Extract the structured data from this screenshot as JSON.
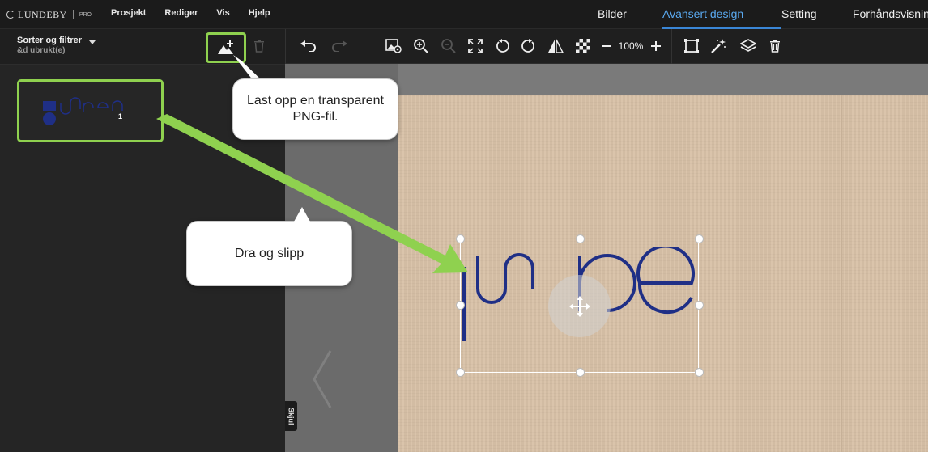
{
  "app": {
    "logo_text": "LUNDEBY",
    "logo_sub": "PRO"
  },
  "menu": {
    "items": [
      "Prosjekt",
      "Rediger",
      "Vis",
      "Hjelp"
    ]
  },
  "tabs": [
    {
      "label": "Bilder",
      "active": false
    },
    {
      "label": "Avansert design",
      "active": true
    },
    {
      "label": "Setting",
      "active": false
    },
    {
      "label": "Forhåndsvisning",
      "active": false
    }
  ],
  "left_panel": {
    "sort_title": "Sorter og filtrer",
    "sort_subtitle": "&d ubrukt(e)",
    "thumbnail": {
      "count": "1"
    }
  },
  "toolbar": {
    "zoom": "100%"
  },
  "hide_tab_label": "Skjul",
  "callouts": {
    "upload": "Last opp en transparent PNG-fil.",
    "drag": "Dra og slipp"
  },
  "colors": {
    "accent_blue": "#3a86d6",
    "highlight_green": "#8fd14f",
    "logo_navy": "#1f2f86",
    "board": "#d9c2a8"
  },
  "icons": [
    "upload-image-icon",
    "trash-icon",
    "undo-icon",
    "redo-icon",
    "image-settings-icon",
    "zoom-in-icon",
    "zoom-out-icon",
    "fit-screen-icon",
    "rotate-left-icon",
    "rotate-right-icon",
    "flip-icon",
    "transparency-icon",
    "minus-icon",
    "plus-icon",
    "crop-frame-icon",
    "magic-wand-icon",
    "layers-icon",
    "move-icon"
  ]
}
